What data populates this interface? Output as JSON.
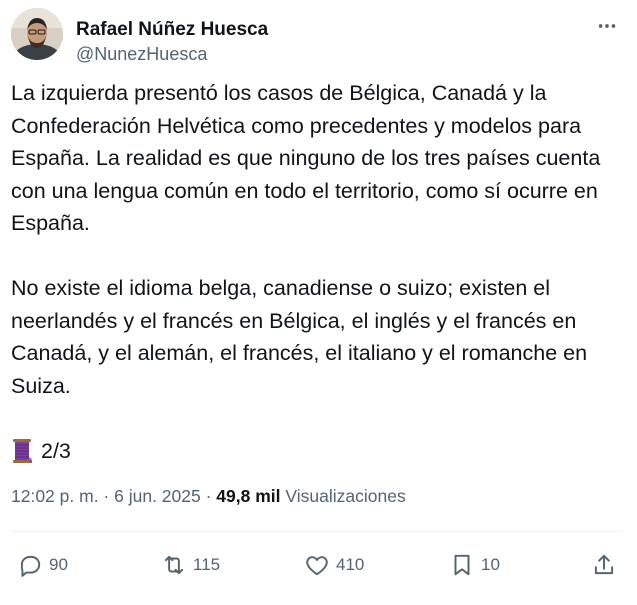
{
  "author": {
    "name": "Rafael Núñez Huesca",
    "handle": "@NunezHuesca"
  },
  "tweet": {
    "paragraphs": [
      "La izquierda presentó los casos de Bélgica, Canadá y la Confederación Helvética como precedentes y modelos para España. La realidad es que ninguno de los tres países cuenta con una lengua común en todo el territorio, como sí ocurre en España.",
      "No existe el idioma belga, canadiense o suizo; existen el neerlandés y el francés en Bélgica, el inglés y el francés en Canadá, y el alemán, el francés, el italiano y el romanche en Suiza."
    ],
    "thread_marker": "2/3",
    "thread_icon": "thread-spool-icon"
  },
  "meta": {
    "time": "12:02 p. m.",
    "separator": " · ",
    "date": "6 jun. 2025",
    "views_count": "49,8 mil",
    "views_label": "Visualizaciones"
  },
  "actions": {
    "replies": "90",
    "retweets": "115",
    "likes": "410",
    "bookmarks": "10"
  },
  "colors": {
    "text": "#0f1419",
    "secondary": "#536471",
    "divider": "#eff3f4",
    "thread_icon": "#7b3fa0"
  }
}
